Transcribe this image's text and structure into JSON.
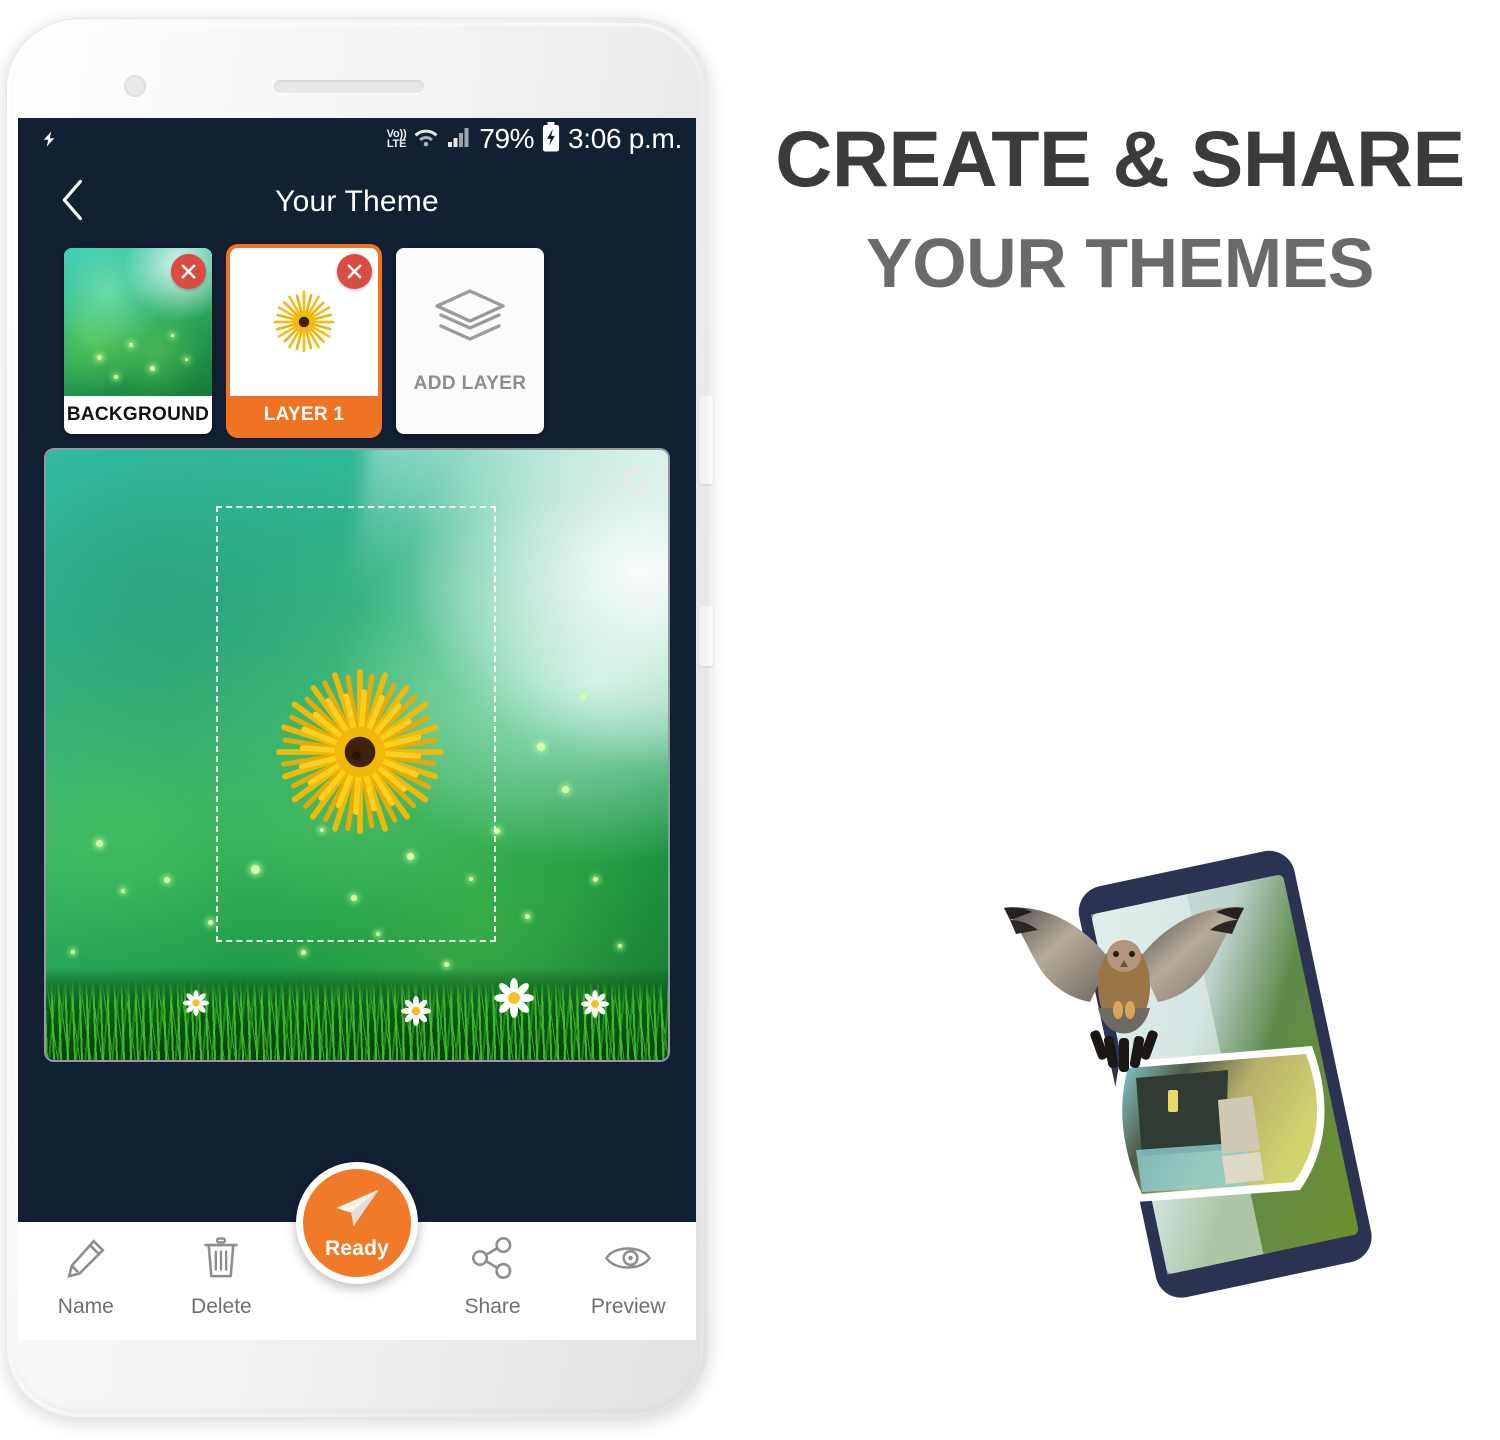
{
  "app": {
    "screen_title": "Your Theme",
    "back_icon": "chevron-left-icon",
    "accent_color": "#f07a28",
    "screen_bg_color": "#131f33"
  },
  "status_bar": {
    "flash_icon": "lightning-bolt-icon",
    "volte_top": "Vo))",
    "volte_bottom": "LTE",
    "wifi_icon": "wifi-icon",
    "signal_icon": "signal-bars-icon",
    "battery_percent": "79%",
    "battery_icon": "battery-charging-icon",
    "time": "3:06 p.m."
  },
  "layers": {
    "cards": [
      {
        "label": "BACKGROUND",
        "selected": false,
        "close_icon": "close-circle-icon",
        "thumb": "green-bokeh-thumbnail"
      },
      {
        "label": "LAYER 1",
        "selected": true,
        "close_icon": "close-circle-icon",
        "thumb": "yellow-flower-thumbnail"
      }
    ],
    "add_layer": {
      "label": "ADD LAYER",
      "icon": "layers-stack-icon"
    }
  },
  "canvas": {
    "reset_icon": "reset-rotate-icon",
    "selection_label": "layer-selection-bounds",
    "content": "yellow-dandelion-flower-on-green-bokeh-grass-background"
  },
  "bottom_bar": {
    "items": [
      {
        "label": "Name",
        "icon": "pencil-icon"
      },
      {
        "label": "Delete",
        "icon": "trash-icon"
      },
      {
        "label": "Share",
        "icon": "share-nodes-icon"
      },
      {
        "label": "Preview",
        "icon": "eye-icon"
      }
    ],
    "fab": {
      "label": "Ready",
      "icon": "paper-plane-icon"
    }
  },
  "promo": {
    "headline_line1": "CREATE & SHARE",
    "headline_line2": "YOUR THEMES",
    "illustration": "falcon-bird-flying-over-tilted-phone-with-peeling-photo"
  }
}
